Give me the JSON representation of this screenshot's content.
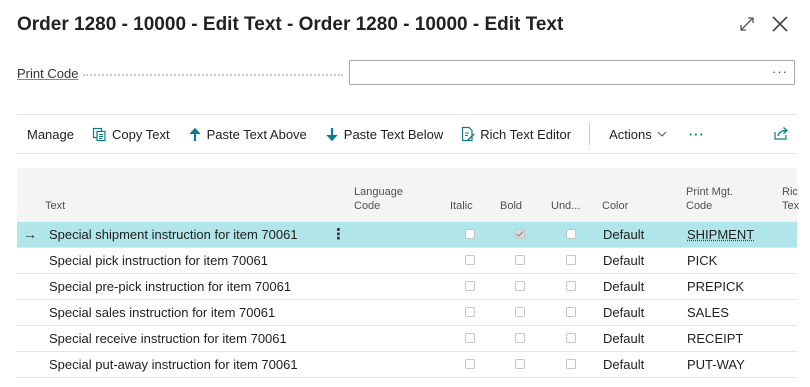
{
  "window": {
    "title": "Order 1280 - 10000 - Edit Text - Order 1280 - 10000 - Edit Text",
    "expand_icon": "expand-icon",
    "close_icon": "close-icon"
  },
  "form": {
    "print_code_label": "Print Code",
    "print_code_value": "",
    "lookup_glyph": "···"
  },
  "toolbar": {
    "manage": "Manage",
    "copy_text": "Copy Text",
    "paste_above": "Paste Text Above",
    "paste_below": "Paste Text Below",
    "rich_text_editor": "Rich Text Editor",
    "actions": "Actions",
    "more": "···"
  },
  "grid": {
    "columns": {
      "text": "Text",
      "language_line1": "Language",
      "language_line2": "Code",
      "italic": "Italic",
      "bold": "Bold",
      "underline": "Und...",
      "color": "Color",
      "print_mgt_line1": "Print Mgt.",
      "print_mgt_line2": "Code",
      "rich_line1": "Ric",
      "rich_line2": "Tex"
    },
    "rows": [
      {
        "text": "Special shipment instruction for item 70061",
        "italic": false,
        "bold": true,
        "underline": false,
        "color": "Default",
        "print_mgt_code": "SHIPMENT",
        "selected": true
      },
      {
        "text": "Special pick instruction for item 70061",
        "italic": false,
        "bold": false,
        "underline": false,
        "color": "Default",
        "print_mgt_code": "PICK",
        "selected": false
      },
      {
        "text": "Special pre-pick instruction for item 70061",
        "italic": false,
        "bold": false,
        "underline": false,
        "color": "Default",
        "print_mgt_code": "PREPICK",
        "selected": false
      },
      {
        "text": "Special sales instruction for item 70061",
        "italic": false,
        "bold": false,
        "underline": false,
        "color": "Default",
        "print_mgt_code": "SALES",
        "selected": false
      },
      {
        "text": "Special receive instruction for item 70061",
        "italic": false,
        "bold": false,
        "underline": false,
        "color": "Default",
        "print_mgt_code": "RECEIPT",
        "selected": false
      },
      {
        "text": "Special put-away instruction for item 70061",
        "italic": false,
        "bold": false,
        "underline": false,
        "color": "Default",
        "print_mgt_code": "PUT-WAY",
        "selected": false
      }
    ],
    "row_arrow": "→",
    "row_menu_glyph": "⋮"
  },
  "colors": {
    "accent": "#0a7c8c",
    "selected_row": "#b0e5e9",
    "header_bg": "#f4f4f4"
  }
}
